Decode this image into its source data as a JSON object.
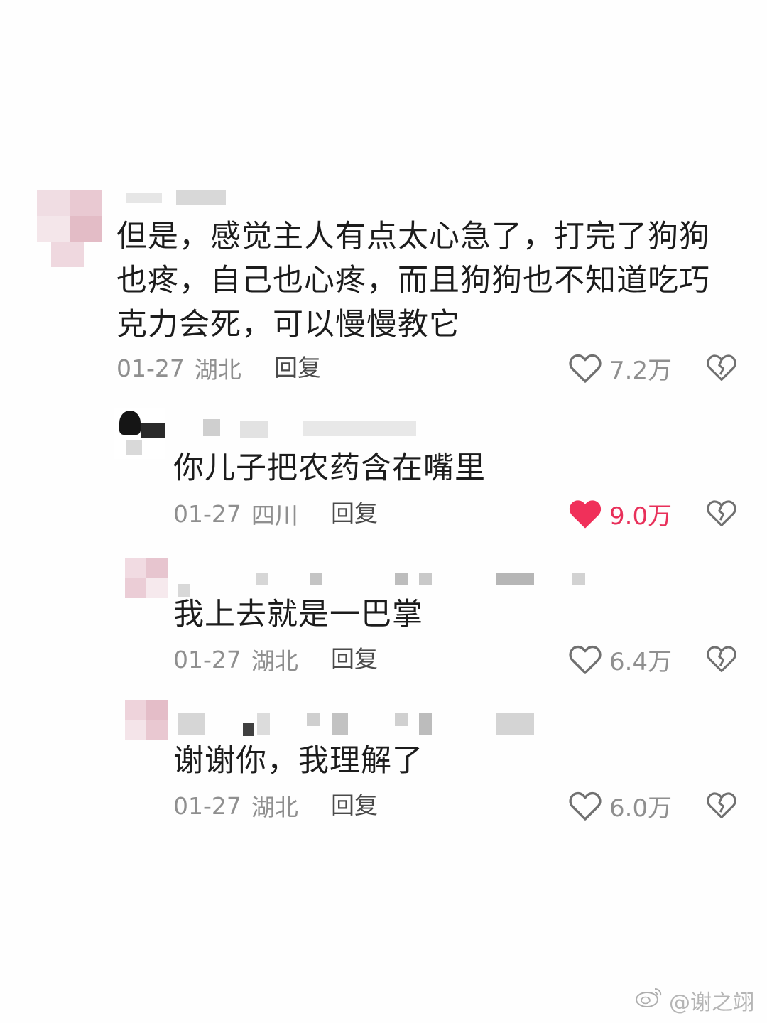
{
  "comments": [
    {
      "text_lines": [
        "但是，感觉主人有点太心急了，打完了狗狗",
        "也疼，自己也心疼，而且狗狗也不知道吃巧",
        "克力会死，可以慢慢教它"
      ],
      "date": "01-27",
      "region": "湖北",
      "reply_label": "回复",
      "likes": "7.2万",
      "liked": false
    },
    {
      "text_lines": [
        "你儿子把农药含在嘴里"
      ],
      "date": "01-27",
      "region": "四川",
      "reply_label": "回复",
      "likes": "9.0万",
      "liked": true
    },
    {
      "text_lines": [
        "我上去就是一巴掌"
      ],
      "date": "01-27",
      "region": "湖北",
      "reply_label": "回复",
      "likes": "6.4万",
      "liked": false
    },
    {
      "text_lines": [
        "谢谢你，我理解了"
      ],
      "date": "01-27",
      "region": "湖北",
      "reply_label": "回复",
      "likes": "6.0万",
      "liked": false
    }
  ],
  "watermark": {
    "text": "@谢之翊",
    "icon": "weibo-icon"
  },
  "colors": {
    "liked_heart": "#f0305a",
    "muted_text": "#8f8f8f",
    "body_text": "#1c1c1c"
  }
}
